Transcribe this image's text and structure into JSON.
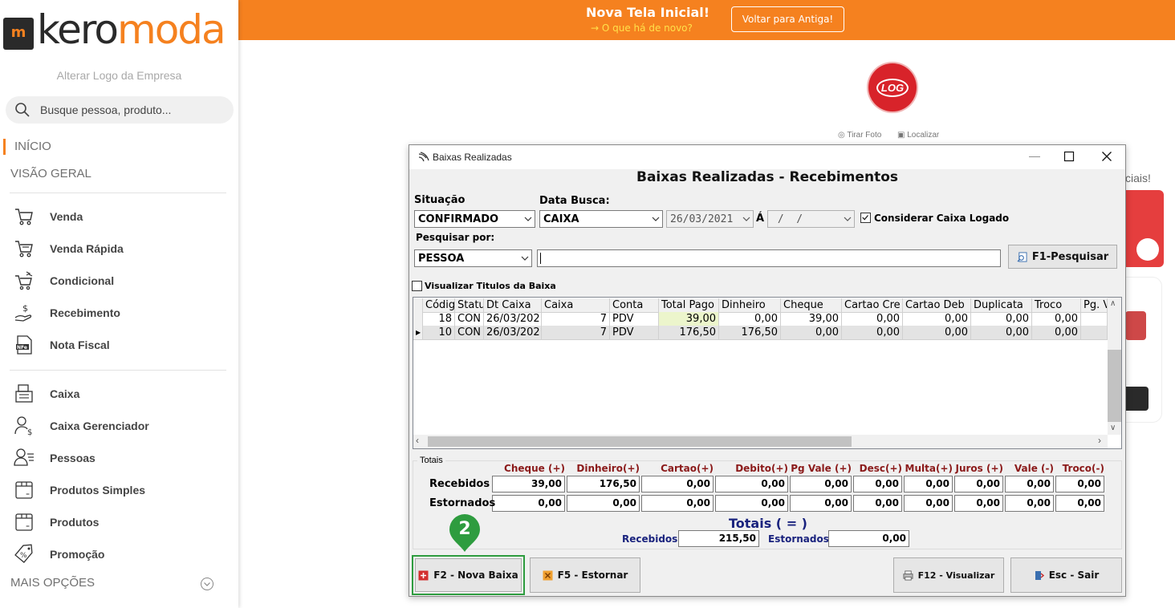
{
  "banner": {
    "title": "Nova Tela Inicial!",
    "subtitle": "→ O que há de novo?",
    "back_button": "Voltar para Antiga!"
  },
  "sidebar": {
    "logo_left": "m",
    "logo_dark": "kero",
    "logo_orange": "moda",
    "alter_logo": "Alterar Logo da Empresa",
    "search_placeholder": "Busque pessoa, produto...",
    "inicio": "INÍCIO",
    "visao_geral": "VISÃO GERAL",
    "items_group1": [
      {
        "label": "Venda",
        "icon": "cart-icon"
      },
      {
        "label": "Venda Rápida",
        "icon": "cart-fast-icon"
      },
      {
        "label": "Condicional",
        "icon": "cart-arrows-icon"
      },
      {
        "label": "Recebimento",
        "icon": "hand-money-icon"
      },
      {
        "label": "Nota Fiscal",
        "icon": "nfe-icon"
      }
    ],
    "items_group2": [
      {
        "label": "Caixa",
        "icon": "cash-register-icon"
      },
      {
        "label": "Caixa Gerenciador",
        "icon": "user-money-icon"
      },
      {
        "label": "Pessoas",
        "icon": "user-list-icon"
      },
      {
        "label": "Produtos Simples",
        "icon": "box-icon"
      },
      {
        "label": "Produtos",
        "icon": "box-icon"
      },
      {
        "label": "Promoção",
        "icon": "tag-percent-icon"
      }
    ],
    "mais_opcoes": "MAIS OPÇÕES"
  },
  "background": {
    "log_badge": "LOG",
    "tirar_foto": "Tirar Foto",
    "localizar": "Localizar",
    "partial_text": "ciais!"
  },
  "dialog": {
    "window_title": "Baixas Realizadas",
    "header": "Baixas Realizadas - Recebimentos",
    "situacao_label": "Situação",
    "situacao_value": "CONFIRMADO",
    "data_busca_label": "Data Busca:",
    "data_busca_value": "CAIXA",
    "date_from": "26/03/2021",
    "a_label": "Á",
    "date_to": " /  /",
    "considerar_label": "Considerar Caixa Logado",
    "considerar_checked": true,
    "pesquisar_label": "Pesquisar por:",
    "pesquisar_value": "PESSOA",
    "pesquisar_input": "",
    "pesquisar_button": "F1-Pesquisar",
    "visualizar_label": "Visualizar Titulos da Baixa",
    "grid": {
      "columns": [
        "Códig",
        "Statu",
        "Dt Caixa",
        "Caixa",
        "Conta",
        "Total Pago",
        "Dinheiro",
        "Cheque",
        "Cartao Cre",
        "Cartao Deb",
        "Duplicata",
        "Troco",
        "Pg. V"
      ],
      "rows": [
        [
          "18",
          "CON",
          "26/03/202",
          "7",
          "PDV",
          "39,00",
          "0,00",
          "39,00",
          "0,00",
          "0,00",
          "0,00",
          "0,00",
          ""
        ],
        [
          "10",
          "CON",
          "26/03/202",
          "7",
          "PDV",
          "176,50",
          "176,50",
          "0,00",
          "0,00",
          "0,00",
          "0,00",
          "0,00",
          ""
        ]
      ]
    },
    "totais_group": "Totais",
    "tot_headers": [
      "Cheque (+)",
      "Dinheiro(+)",
      "Cartao(+)",
      "Debito(+)",
      "Pg Vale (+)",
      "Desc(+)",
      "Multa(+)",
      "Juros (+)",
      "Vale (-)",
      "Troco(-)"
    ],
    "recebidos_label": "Recebidos",
    "estornados_label": "Estornados",
    "recebidos_values": [
      "39,00",
      "176,50",
      "0,00",
      "0,00",
      "0,00",
      "0,00",
      "0,00",
      "0,00",
      "0,00",
      "0,00"
    ],
    "estornados_values": [
      "0,00",
      "0,00",
      "0,00",
      "0,00",
      "0,00",
      "0,00",
      "0,00",
      "0,00",
      "0,00",
      "0,00"
    ],
    "totais_title": "Totais ( = )",
    "tot_recebidos_label": "Recebidos",
    "tot_recebidos_value": "215,50",
    "tot_estornados_label": "Estornados",
    "tot_estornados_value": "0,00",
    "buttons": {
      "nova_baixa": "F2 - Nova Baixa",
      "estornar": "F5 - Estornar",
      "visualizar": "F12 - Visualizar",
      "sair": "Esc - Sair"
    },
    "step_badge": "2"
  },
  "colors": {
    "brand_orange": "#f5811f",
    "highlight_green": "#2e9c3f",
    "totals_red": "#8b1a1a",
    "totals_navy": "#1a237e"
  }
}
